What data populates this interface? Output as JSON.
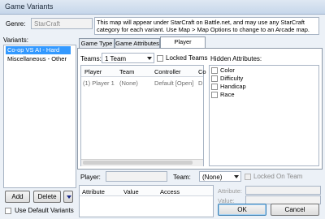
{
  "window": {
    "title": "Game Variants"
  },
  "genre": {
    "label": "Genre:",
    "value": "StarCraft"
  },
  "info_text": "This map will appear under StarCraft on Battle.net, and may use any StarCraft category for each variant. Use Map > Map Options to change to an Arcade map.",
  "variants": {
    "label": "Variants:",
    "items": [
      {
        "label": "Co-op VS AI - Hard",
        "selected": true
      },
      {
        "label": "Miscellaneous - Other",
        "selected": false
      }
    ],
    "add_label": "Add",
    "delete_label": "Delete",
    "use_default_label": "Use Default Variants"
  },
  "tabs": [
    {
      "label": "Game Type",
      "active": false
    },
    {
      "label": "Game Attributes",
      "active": false
    },
    {
      "label": "Player Attributes",
      "active": true
    }
  ],
  "teams": {
    "label": "Teams:",
    "value": "1 Team",
    "locked_label": "Locked Teams"
  },
  "players_table": {
    "headers": [
      "Player",
      "Team",
      "Controller",
      "Co"
    ],
    "rows": [
      [
        "(1) Player 1",
        "(None)",
        "Default [Open]",
        "D"
      ]
    ]
  },
  "hidden_attributes": {
    "label": "Hidden Attributes:",
    "items": [
      "Color",
      "Difficulty",
      "Handicap",
      "Race"
    ]
  },
  "player_row": {
    "label": "Player:",
    "team_label": "Team:",
    "team_value": "(None)",
    "locked_on_team_label": "Locked On Team"
  },
  "attr_table": {
    "headers": [
      "Attribute",
      "Value",
      "Access"
    ]
  },
  "side_fields": {
    "attribute_label": "Attribute:",
    "value_label": "Value:"
  },
  "footer": {
    "ok_label": "OK",
    "cancel_label": "Cancel"
  },
  "colors": {
    "selection": "#3399ff",
    "window_bg": "#ecf1f7"
  }
}
